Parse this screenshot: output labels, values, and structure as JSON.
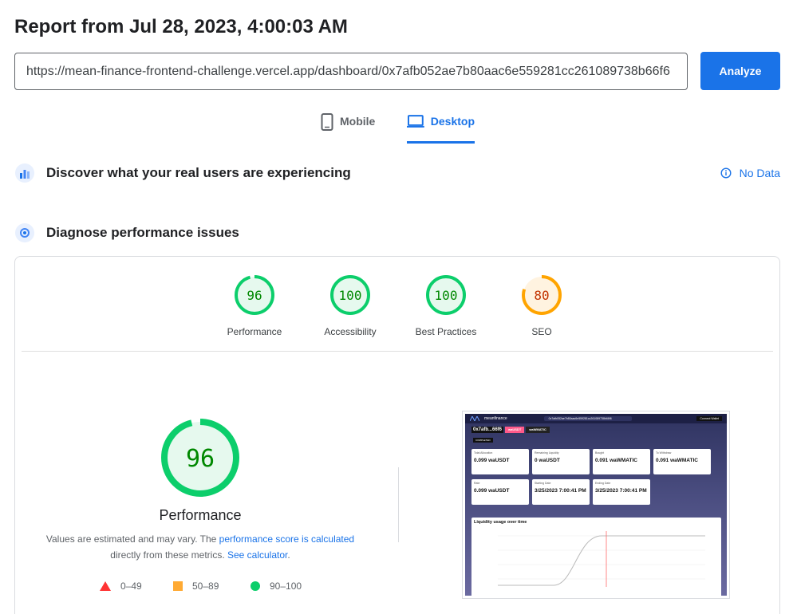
{
  "header": {
    "title": "Report from Jul 28, 2023, 4:00:03 AM"
  },
  "url_field": {
    "value": "https://mean-finance-frontend-challenge.vercel.app/dashboard/0x7afb052ae7b80aac6e559281cc261089738b66f6"
  },
  "analyze_label": "Analyze",
  "tabs": [
    {
      "label": "Mobile",
      "icon": "phone-icon",
      "active": false
    },
    {
      "label": "Desktop",
      "icon": "laptop-icon",
      "active": true
    }
  ],
  "field_data": {
    "title": "Discover what your real users are experiencing",
    "status": "No Data"
  },
  "lab_data": {
    "title": "Diagnose performance issues"
  },
  "scores": [
    {
      "label": "Performance",
      "value": "96",
      "fraction": 0.96,
      "status": "pass"
    },
    {
      "label": "Accessibility",
      "value": "100",
      "fraction": 1.0,
      "status": "pass"
    },
    {
      "label": "Best Practices",
      "value": "100",
      "fraction": 1.0,
      "status": "pass"
    },
    {
      "label": "SEO",
      "value": "80",
      "fraction": 0.8,
      "status": "average"
    }
  ],
  "big_score": {
    "value": "96",
    "label": "Performance",
    "fraction": 0.96
  },
  "description": {
    "pre": "Values are estimated and may vary. The ",
    "link1": "performance score is calculated",
    "mid": " directly from these metrics. ",
    "link2": "See calculator",
    "post": "."
  },
  "legend": [
    {
      "range": "0–49",
      "shape": "triangle",
      "color": "#ff3333"
    },
    {
      "range": "50–89",
      "shape": "square",
      "color": "#ffaa33"
    },
    {
      "range": "90–100",
      "shape": "circle",
      "color": "#0cce6b"
    }
  ],
  "colors": {
    "pass": "#0cce6b",
    "pass_text": "#008800",
    "pass_bg": "#e6f9ee",
    "average": "#ffa400",
    "average_text": "#c33300",
    "average_bg": "#fff3e0",
    "accent": "#1a73e8"
  },
  "screenshot": {
    "brand": "meanfinance",
    "address": "0x7afb052ae7b80aac6e559281cc261089738b66f6",
    "connect": "Connect Wallet",
    "pos_id": "0x7afb...66f6",
    "from_token": "waUSDT",
    "to_token": "waWMATIC",
    "state": "COMPLETED",
    "chart_title": "Liquidity usage over time",
    "cards": [
      {
        "label": "Total Allocation",
        "value": "0.099 waUSDT"
      },
      {
        "label": "Remaining Liquidity",
        "value": "0 waUSDT"
      },
      {
        "label": "Bought",
        "value": "0.091 waWMATIC"
      },
      {
        "label": "To Withdraw",
        "value": "0.091 waWMATIC"
      },
      {
        "label": "Rate",
        "value": "0.099 waUSDT"
      },
      {
        "label": "Starting Date",
        "value": "3/25/2023 7:00:41 PM"
      },
      {
        "label": "Ending Date",
        "value": "3/25/2023 7:00:41 PM"
      }
    ]
  }
}
